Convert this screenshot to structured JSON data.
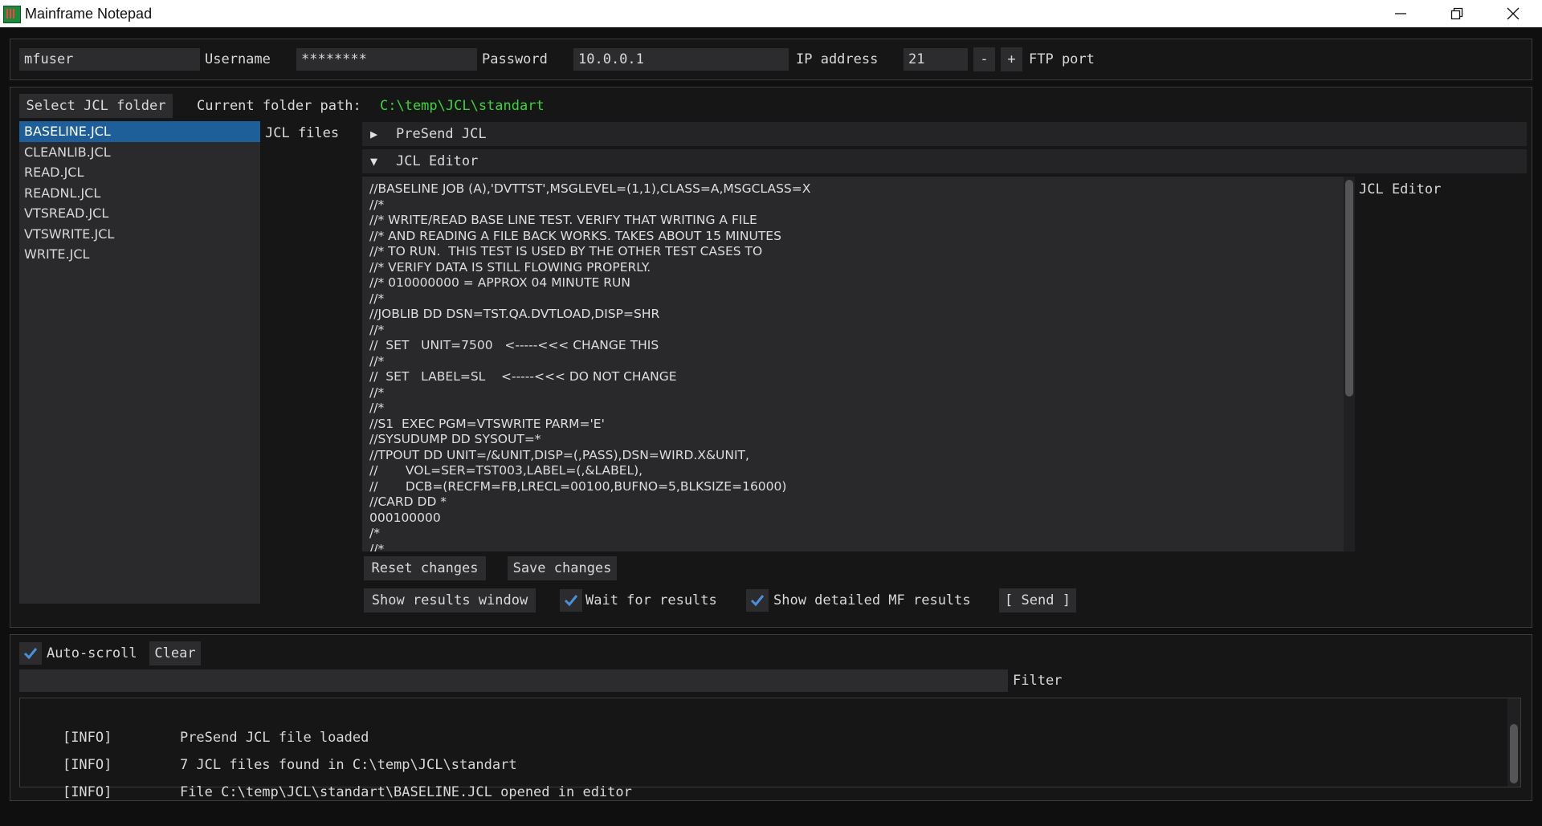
{
  "window": {
    "title": "Mainframe Notepad"
  },
  "connection": {
    "username_value": "mfuser",
    "username_label": "Username",
    "password_value": "********",
    "password_label": "Password",
    "ip_value": "10.0.0.1",
    "ip_label": "IP address",
    "port_value": "21",
    "port_minus": "-",
    "port_plus": "+",
    "port_label": "FTP port"
  },
  "folder": {
    "select_button": "Select JCL folder",
    "path_label": "Current folder path:",
    "path_value": "C:\\temp\\JCL\\standart",
    "path_color": "#3ad53a"
  },
  "files": {
    "label": "JCL files",
    "items": [
      "BASELINE.JCL",
      "CLEANLIB.JCL",
      "READ.JCL",
      "READNL.JCL",
      "VTSREAD.JCL",
      "VTSWRITE.JCL",
      "WRITE.JCL"
    ],
    "selected": "BASELINE.JCL"
  },
  "presend": {
    "label": "PreSend JCL",
    "state": "collapsed"
  },
  "editor": {
    "header": "JCL Editor",
    "side_label": "JCL Editor",
    "state": "expanded",
    "content": "//BASELINE JOB (A),'DVTTST',MSGLEVEL=(1,1),CLASS=A,MSGCLASS=X\n//*\n//* WRITE/READ BASE LINE TEST. VERIFY THAT WRITING A FILE\n//* AND READING A FILE BACK WORKS. TAKES ABOUT 15 MINUTES\n//* TO RUN.  THIS TEST IS USED BY THE OTHER TEST CASES TO\n//* VERIFY DATA IS STILL FLOWING PROPERLY.\n//* 010000000 = APPROX 04 MINUTE RUN\n//*\n//JOBLIB DD DSN=TST.QA.DVTLOAD,DISP=SHR\n//*\n//  SET   UNIT=7500   <-----<<< CHANGE THIS\n//*\n//  SET   LABEL=SL    <-----<<< DO NOT CHANGE\n//*\n//*\n//S1  EXEC PGM=VTSWRITE PARM='E'\n//SYSUDUMP DD SYSOUT=*\n//TPOUT DD UNIT=/&UNIT,DISP=(,PASS),DSN=WIRD.X&UNIT,\n//       VOL=SER=TST003,LABEL=(,&LABEL),\n//       DCB=(RECFM=FB,LRECL=00100,BUFNO=5,BLKSIZE=16000)\n//CARD DD *\n000100000\n/*\n//*",
    "reset_button": "Reset changes",
    "save_button": "Save changes"
  },
  "actions": {
    "show_results_button": "Show results window",
    "wait_checkbox_label": "Wait for results",
    "wait_checked": true,
    "detailed_checkbox_label": "Show detailed MF results",
    "detailed_checked": true,
    "send_button": "[ Send ]"
  },
  "log": {
    "autoscroll_label": "Auto-scroll",
    "autoscroll_checked": true,
    "clear_button": "Clear",
    "filter_value": "",
    "filter_label": "Filter",
    "entries": [
      {
        "level": "[INFO]",
        "message": "PreSend JCL file loaded"
      },
      {
        "level": "[INFO]",
        "message": "7 JCL files found in C:\\temp\\JCL\\standart"
      },
      {
        "level": "[INFO]",
        "message": "File C:\\temp\\JCL\\standart\\BASELINE.JCL opened in editor"
      }
    ]
  },
  "colors": {
    "accent_check": "#4a90d9",
    "selection": "#1f5f99"
  },
  "icons": {
    "minimize": "minimize-icon",
    "restore": "restore-icon",
    "close": "close-icon",
    "collapsed_arrow": "triangle-right-icon",
    "expanded_arrow": "triangle-down-icon",
    "checkmark": "checkmark-icon"
  }
}
